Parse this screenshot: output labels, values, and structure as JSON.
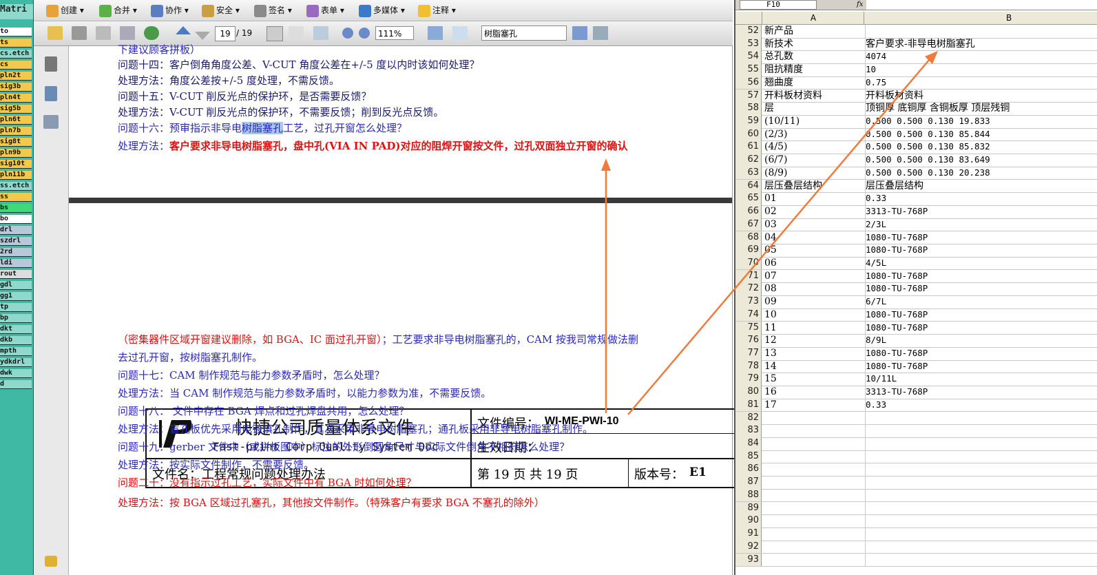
{
  "matrix": {
    "title": "Matri",
    "rows": [
      {
        "label": "to",
        "color": "#ffffff"
      },
      {
        "label": "ts",
        "color": "#f2c94c"
      },
      {
        "label": "cs.etch",
        "color": "#8fd8cc"
      },
      {
        "label": "cs",
        "color": "#f2c94c"
      },
      {
        "label": "pln2t",
        "color": "#f2c94c"
      },
      {
        "label": "sig3b",
        "color": "#f2c94c"
      },
      {
        "label": "pln4t",
        "color": "#f2c94c"
      },
      {
        "label": "sig5b",
        "color": "#f2c94c"
      },
      {
        "label": "pln6t",
        "color": "#f2c94c"
      },
      {
        "label": "pln7b",
        "color": "#f2c94c"
      },
      {
        "label": "sig8t",
        "color": "#f2c94c"
      },
      {
        "label": "pln9b",
        "color": "#f2c94c"
      },
      {
        "label": "sig10t",
        "color": "#f2c94c"
      },
      {
        "label": "pln11b",
        "color": "#f2c94c"
      },
      {
        "label": "ss.etch",
        "color": "#8fd8cc"
      },
      {
        "label": "ss",
        "color": "#f2c94c"
      },
      {
        "label": "bs",
        "color": "#3fd87a"
      },
      {
        "label": "bo",
        "color": "#ffffff"
      },
      {
        "label": "drl",
        "color": "#b8c8d8"
      },
      {
        "label": "szdrl",
        "color": "#b8c8d8"
      },
      {
        "label": "2rd",
        "color": "#b8c8d8"
      },
      {
        "label": "ldi",
        "color": "#b8c8d8"
      },
      {
        "label": "rout",
        "color": "#dddddd"
      },
      {
        "label": "gdl",
        "color": "#8fd8cc"
      },
      {
        "label": "gg1",
        "color": "#8fd8cc"
      },
      {
        "label": "tp",
        "color": "#8fd8cc"
      },
      {
        "label": "bp",
        "color": "#8fd8cc"
      },
      {
        "label": "dkt",
        "color": "#8fd8cc"
      },
      {
        "label": "dkb",
        "color": "#8fd8cc"
      },
      {
        "label": "mpth",
        "color": "#8fd8cc"
      },
      {
        "label": "ydkdrl",
        "color": "#8fd8cc"
      },
      {
        "label": "dwk",
        "color": "#8fd8cc"
      },
      {
        "label": "d",
        "color": "#8fd8cc"
      }
    ]
  },
  "toolbar1": {
    "create": "创建 ▾",
    "merge": "合并 ▾",
    "collab": "协作 ▾",
    "security": "安全 ▾",
    "sign": "签名 ▾",
    "forms": "表单 ▾",
    "multimedia": "多媒体 ▾",
    "comment": "注释 ▾"
  },
  "toolbar2": {
    "page_current": "19",
    "page_total": "/ 19",
    "zoom": "111%",
    "search_value": "树脂塞孔"
  },
  "page1": {
    "line0": "下建议顾客拼板）",
    "q14": "问题十四：客户倒角角度公差、V-CUT 角度公差在+/-5 度以内时该如何处理？",
    "a14": "处理方法：角度公差按+/-5 度处理，不需反馈。",
    "q15": "问题十五：V-CUT 削反光点的保护环，是否需要反馈？",
    "a15": "处理方法：V-CUT 削反光点的保护环，不需要反馈；削到反光点反馈。",
    "q16_a": "问题十六：预审指示非导电",
    "q16_hl": "树脂塞孔",
    "q16_b": "工艺，过孔开窗怎么处理？",
    "a16_label": "处理方法：",
    "a16_text": "客户要求非导电树脂塞孔，盘中孔(VIA IN PAD)对应的阻焊开窗按文件，过孔双面独立开窗的确认"
  },
  "header": {
    "company_cn": "快捷公司质量体系文件",
    "company_en": "Fast-print Corp Quality System Doc",
    "docno_label": "文件编号：",
    "docno_value": "WI-ME-PWI-10",
    "effective_label": "生效日期：",
    "filename": "文件名：工程常规问题处理办法",
    "pageinfo": "第 19 页 共 19 页",
    "version_label": "版本号：",
    "version_value": "E1"
  },
  "page2": {
    "l1_red": "（密集器件区域开窗建议删除，如 BGA、IC 面过孔开窗）",
    "l1_blue": "；工艺要求非导电树脂塞孔的，CAM 按我司常规做法删",
    "l2": "去过孔开窗，按树脂塞孔制作。",
    "q17": "问题十七：CAM 制作规范与能力参数矛盾时，怎么处理？",
    "a17": "处理方法：当 CAM 制作规范与能力参数矛盾时，以能力参数为准，不需要反馈。",
    "q18": "问题十八：  文件中存在 BGA 焊点和过孔焊盘共用，怎么处理？",
    "a18": "处理方法：盲孔板优先采用电镀填孔制作，其次采用非导电树脂塞孔；通孔板采用非导电树脂塞孔制作。",
    "q19": "问题十九：gerber 文件中（或拼板图中）标注的外形倒圆角尺寸与实际文件倒角不相符怎么处理？",
    "a19": "处理方法：按实际文件制作，不需要反馈。",
    "q20": "问题二十：没有指示过孔工艺，实际文件中有 BGA 时如何处理？",
    "a20": "处理方法：按 BGA 区域过孔塞孔，其他按文件制作。（特殊客户有要求 BGA 不塞孔的除外）"
  },
  "excel": {
    "namebox": "F10",
    "fx": "fx",
    "col_a": "A",
    "col_b": "B",
    "rows": [
      {
        "n": "52",
        "a": "新产品",
        "b": ""
      },
      {
        "n": "53",
        "a": "新技术",
        "b": "客户要求-非导电树脂塞孔"
      },
      {
        "n": "54",
        "a": "总孔数",
        "b": "4074"
      },
      {
        "n": "55",
        "a": "阻抗精度",
        "b": "10"
      },
      {
        "n": "56",
        "a": "翘曲度",
        "b": "0.75"
      },
      {
        "n": "57",
        "a": "开料板材资料",
        "b": "开料板材资料"
      },
      {
        "n": "58",
        "a": "层",
        "b": "顶铜厚 底铜厚  含铜板厚  顶层残铜"
      },
      {
        "n": "59",
        "a": "(10/11)",
        "b": "0.500  0.500          0.130        19.833"
      },
      {
        "n": "60",
        "a": "(2/3)",
        "b": "0.500  0.500          0.130        85.844"
      },
      {
        "n": "61",
        "a": "(4/5)",
        "b": "0.500  0.500          0.130        85.832"
      },
      {
        "n": "62",
        "a": "(6/7)",
        "b": "0.500  0.500          0.130        83.649"
      },
      {
        "n": "63",
        "a": "(8/9)",
        "b": "0.500  0.500          0.130        20.238"
      },
      {
        "n": "64",
        "a": "层压叠层结构",
        "b": "层压叠层结构"
      },
      {
        "n": "65",
        "a": "01",
        "b": "0.33"
      },
      {
        "n": "66",
        "a": "02",
        "b": "3313-TU-768P"
      },
      {
        "n": "67",
        "a": "03",
        "b": "2/3L"
      },
      {
        "n": "68",
        "a": "04",
        "b": "1080-TU-768P"
      },
      {
        "n": "69",
        "a": "05",
        "b": "1080-TU-768P"
      },
      {
        "n": "70",
        "a": "06",
        "b": "4/5L"
      },
      {
        "n": "71",
        "a": "07",
        "b": "1080-TU-768P"
      },
      {
        "n": "72",
        "a": "08",
        "b": "1080-TU-768P"
      },
      {
        "n": "73",
        "a": "09",
        "b": "6/7L"
      },
      {
        "n": "74",
        "a": "10",
        "b": "1080-TU-768P"
      },
      {
        "n": "75",
        "a": "11",
        "b": "1080-TU-768P"
      },
      {
        "n": "76",
        "a": "12",
        "b": "8/9L"
      },
      {
        "n": "77",
        "a": "13",
        "b": "1080-TU-768P"
      },
      {
        "n": "78",
        "a": "14",
        "b": "1080-TU-768P"
      },
      {
        "n": "79",
        "a": "15",
        "b": "10/11L"
      },
      {
        "n": "80",
        "a": "16",
        "b": "3313-TU-768P"
      },
      {
        "n": "81",
        "a": "17",
        "b": "0.33"
      },
      {
        "n": "82",
        "a": "",
        "b": ""
      },
      {
        "n": "83",
        "a": "",
        "b": ""
      },
      {
        "n": "84",
        "a": "",
        "b": ""
      },
      {
        "n": "85",
        "a": "",
        "b": ""
      },
      {
        "n": "86",
        "a": "",
        "b": ""
      },
      {
        "n": "87",
        "a": "",
        "b": ""
      },
      {
        "n": "88",
        "a": "",
        "b": ""
      },
      {
        "n": "89",
        "a": "",
        "b": ""
      },
      {
        "n": "90",
        "a": "",
        "b": ""
      },
      {
        "n": "91",
        "a": "",
        "b": ""
      },
      {
        "n": "92",
        "a": "",
        "b": ""
      },
      {
        "n": "93",
        "a": "",
        "b": ""
      }
    ]
  },
  "colors": {
    "arrow": "#f07a3a",
    "highlight": "#a8c8f0"
  }
}
